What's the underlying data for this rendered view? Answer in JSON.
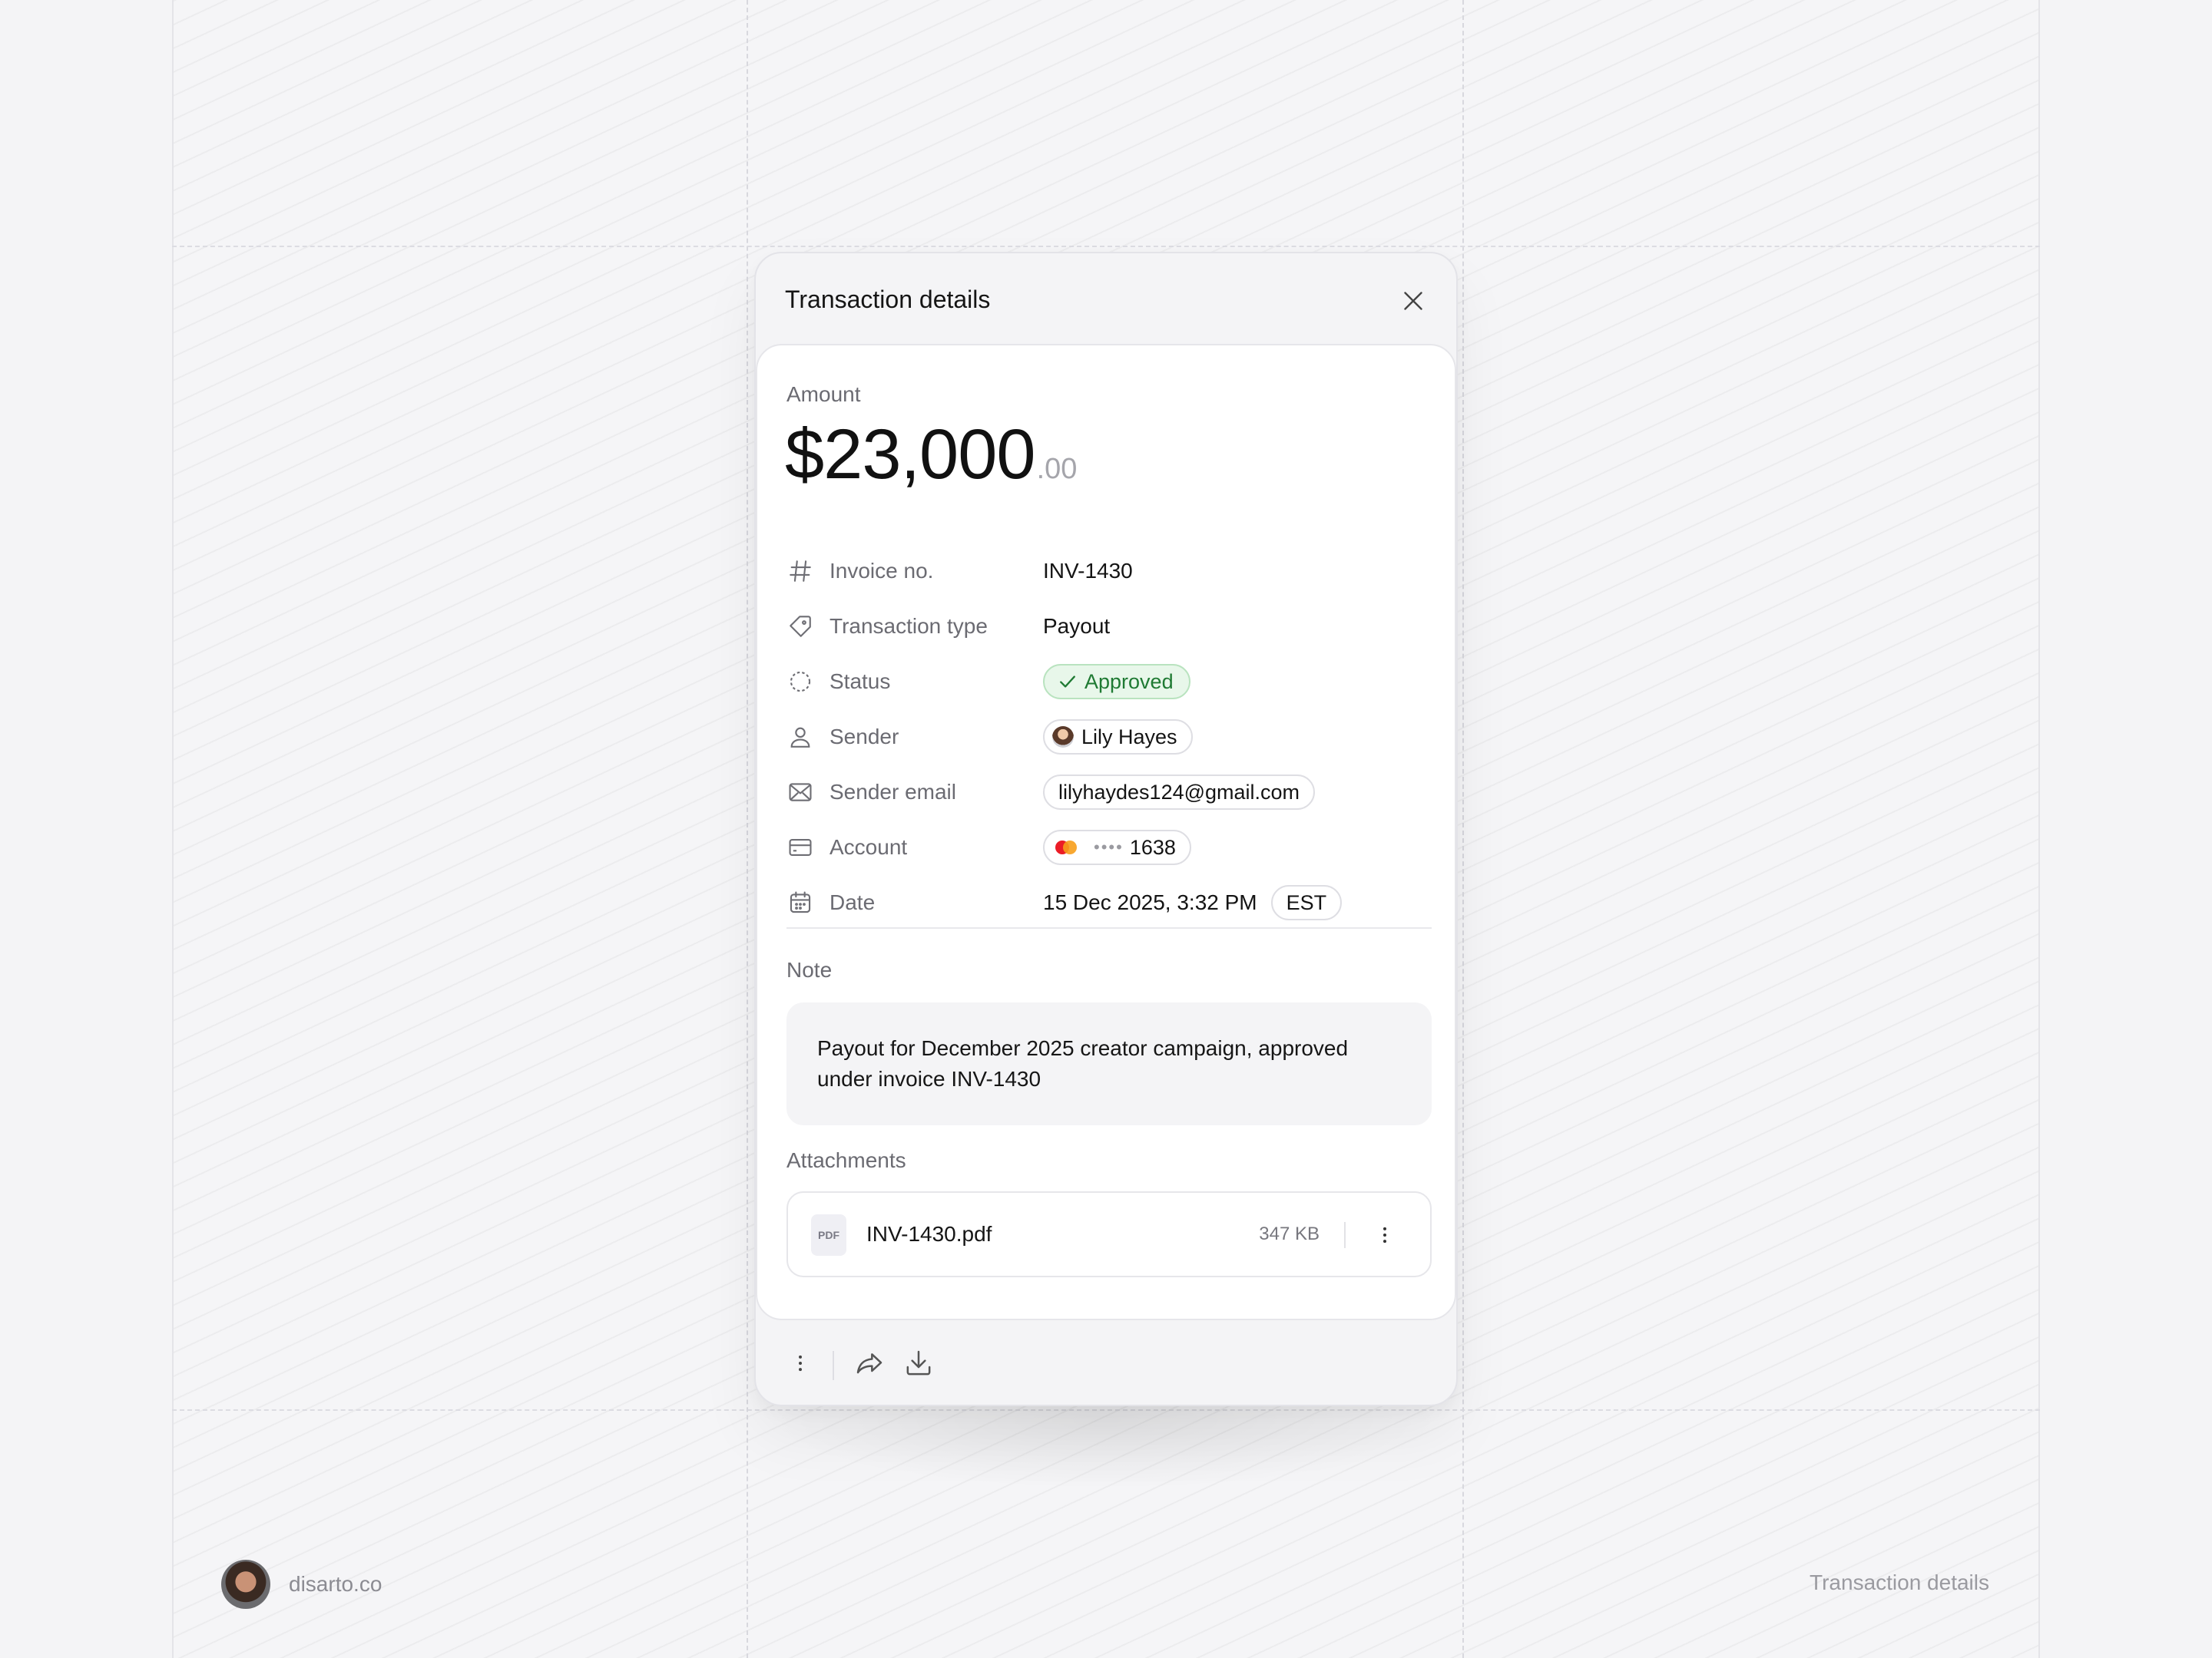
{
  "panel": {
    "title": "Transaction details"
  },
  "amount": {
    "label": "Amount",
    "main": "$23,000",
    "cents": ".00"
  },
  "details": [
    {
      "icon": "hash-icon",
      "label": "Invoice no.",
      "value": "INV-1430"
    },
    {
      "icon": "tag-icon",
      "label": "Transaction type",
      "value": "Payout"
    },
    {
      "icon": "status-circle-icon",
      "label": "Status",
      "value": "Approved"
    },
    {
      "icon": "user-icon",
      "label": "Sender",
      "value": "Lily Hayes"
    },
    {
      "icon": "mail-icon",
      "label": "Sender email",
      "value": "lilyhaydes124@gmail.com"
    },
    {
      "icon": "credit-card-icon",
      "label": "Account",
      "dots": "••••",
      "value": "1638"
    },
    {
      "icon": "calendar-icon",
      "label": "Date",
      "value": "15 Dec 2025, 3:32 PM",
      "timezone": "EST"
    }
  ],
  "note": {
    "label": "Note",
    "text": "Payout for December 2025 creator campaign, approved under invoice INV-1430"
  },
  "attachments": {
    "label": "Attachments",
    "items": [
      {
        "icon_text": "PDF",
        "name": "INV-1430.pdf",
        "size": "347 KB"
      }
    ]
  },
  "colors": {
    "approved_bg": "#e8f7ea",
    "approved_text": "#1f7a33",
    "mastercard_red": "#eb1c26",
    "mastercard_orange": "#f79e1b"
  },
  "branding": {
    "site": "disarto.co",
    "corner_label": "Transaction details"
  }
}
